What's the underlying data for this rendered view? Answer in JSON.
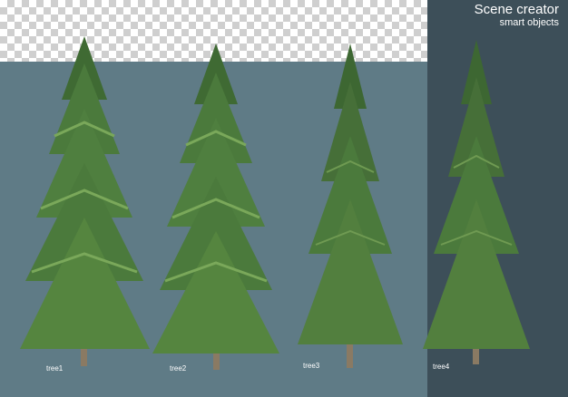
{
  "brand": {
    "title": "Scene creator",
    "subtitle": "smart objects"
  },
  "trees": [
    {
      "label": "tree1"
    },
    {
      "label": "tree2"
    },
    {
      "label": "tree3"
    },
    {
      "label": "tree4"
    }
  ],
  "colors": {
    "panel": "#5f7b86",
    "dark_panel": "#3d4f59",
    "foliage": "#4b7a3c",
    "foliage_light": "#7aa85a",
    "trunk": "#8a7a63"
  }
}
